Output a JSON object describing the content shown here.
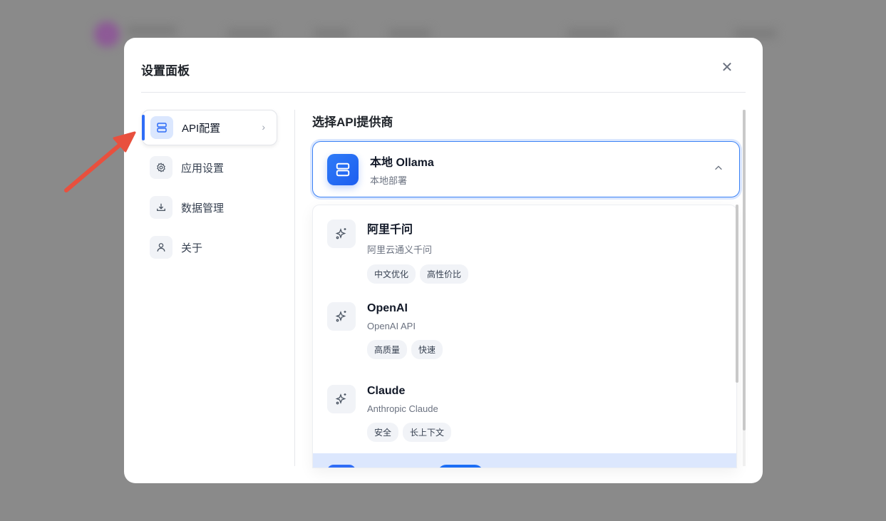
{
  "modal": {
    "title": "设置面板",
    "close_icon": "close-icon"
  },
  "sidebar": {
    "items": [
      {
        "label": "API配置",
        "icon": "server-icon",
        "active": true
      },
      {
        "label": "应用设置",
        "icon": "gear-icon"
      },
      {
        "label": "数据管理",
        "icon": "download-icon"
      },
      {
        "label": "关于",
        "icon": "user-icon"
      }
    ]
  },
  "main": {
    "heading": "选择API提供商",
    "selected": {
      "name": "本地 Ollama",
      "sub": "本地部署"
    },
    "options": [
      {
        "name": "阿里千问",
        "sub": "阿里云通义千问",
        "tags": [
          "中文优化",
          "高性价比"
        ]
      },
      {
        "name": "OpenAI",
        "sub": "OpenAI API",
        "tags": [
          "高质量",
          "快速"
        ]
      },
      {
        "name": "Claude",
        "sub": "Anthropic Claude",
        "tags": [
          "安全",
          "长上下文"
        ]
      }
    ]
  },
  "colors": {
    "accent": "#2f6df6",
    "annotation_arrow": "#e8503e"
  }
}
